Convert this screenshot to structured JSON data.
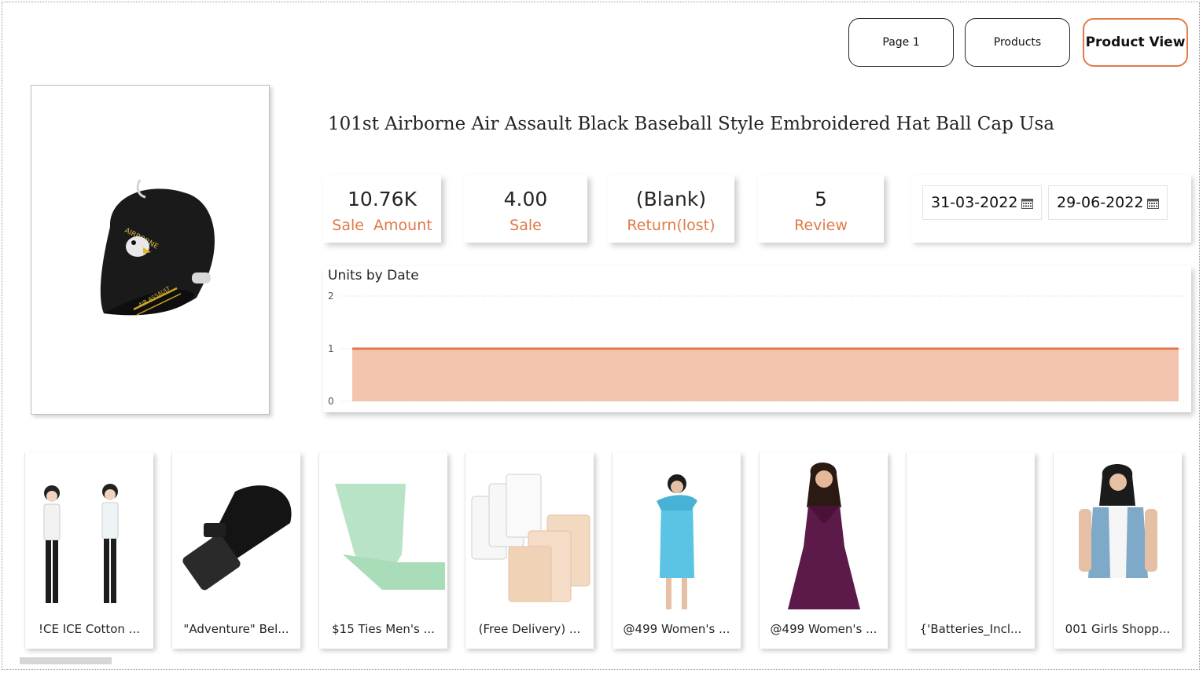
{
  "nav": {
    "page1": "Page 1",
    "products": "Products",
    "product_view": "Product View"
  },
  "product": {
    "title": "101st Airborne Air Assault Black Baseball Style Embroidered Hat Ball Cap Usa",
    "cap_text_front": "AIRBORNE",
    "cap_text_brim": "AIR ASSAULT"
  },
  "kpis": [
    {
      "value": "10.76K",
      "label": "Sale  Amount"
    },
    {
      "value": "4.00",
      "label": "Sale"
    },
    {
      "value": "(Blank)",
      "label": "Return(lost)"
    },
    {
      "value": "5",
      "label": "Review"
    }
  ],
  "date_range": {
    "start": "31-03-2022",
    "end": "29-06-2022"
  },
  "chart_data": {
    "type": "area",
    "title": "Units by Date",
    "x": [
      "start",
      "end"
    ],
    "values": [
      1,
      1
    ],
    "ylim": [
      0,
      2
    ],
    "yticks": [
      "0",
      "1",
      "2"
    ],
    "grid": true,
    "line_color": "#e07a48",
    "fill_color": "#f4c5ae"
  },
  "thumbnails": [
    {
      "caption": "!CE ICE Cotton ..."
    },
    {
      "caption": "\"Adventure\" Bel..."
    },
    {
      "caption": "$15 Ties Men's ..."
    },
    {
      "caption": "(Free Delivery) ..."
    },
    {
      "caption": "@499 Women's ..."
    },
    {
      "caption": "@499 Women's ..."
    },
    {
      "caption": "{'Batteries_Incl..."
    },
    {
      "caption": "001 Girls Shopp..."
    }
  ],
  "colors": {
    "accent": "#e07a48",
    "text": "#252423"
  }
}
